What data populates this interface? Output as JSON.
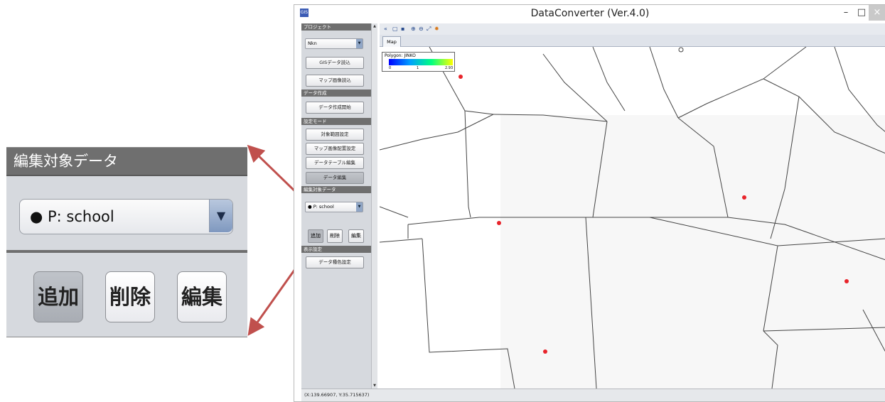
{
  "callout": {
    "header": "編集対象データ",
    "combo_value": "● P: school",
    "combo_arrow": "▼",
    "buttons": {
      "add": "追加",
      "delete": "削除",
      "edit": "編集"
    }
  },
  "window": {
    "title": "DataConverter (Ver.4.0)",
    "app_icon": "GIS",
    "controls": {
      "minimize": "–",
      "maximize": "□",
      "close": "×"
    }
  },
  "panel": {
    "project_header": "プロジェクト",
    "project_value": "Nkn",
    "load_gis": "GISデータ読込",
    "load_map": "マップ画像読込",
    "data_create_header": "データ作成",
    "start_create": "データ作成開始",
    "settings_header": "設定モード",
    "range_setting": "対象範囲設定",
    "map_placement": "マップ画像配置設定",
    "table_edit": "データテーブル編集",
    "data_edit": "データ編集",
    "edit_target_header": "編集対象データ",
    "edit_target_value": "● P: school",
    "add": "追加",
    "delete": "削除",
    "edit": "編集",
    "display_header": "表示設定",
    "color_setting": "データ種色設定"
  },
  "toolbar": {
    "icons": [
      "back-icon",
      "new-icon",
      "save-icon",
      "zoom-in-icon",
      "zoom-out-icon",
      "fit-icon",
      "settings-icon"
    ],
    "glyphs": [
      "«",
      "▢",
      "▪",
      "⊕",
      "⊖",
      "⤢",
      "✹"
    ]
  },
  "tabs": {
    "map": "Map"
  },
  "legend": {
    "title": "Polygon: JINKO",
    "min": "0",
    "mid": "1",
    "max": "2.93"
  },
  "status": "(X:139.66907, Y:35.715637)",
  "colors": {
    "header_gray": "#6f6f6f",
    "panel_bg": "#d6d9de",
    "arrow": "#c0504d",
    "point": "#e8242b"
  }
}
